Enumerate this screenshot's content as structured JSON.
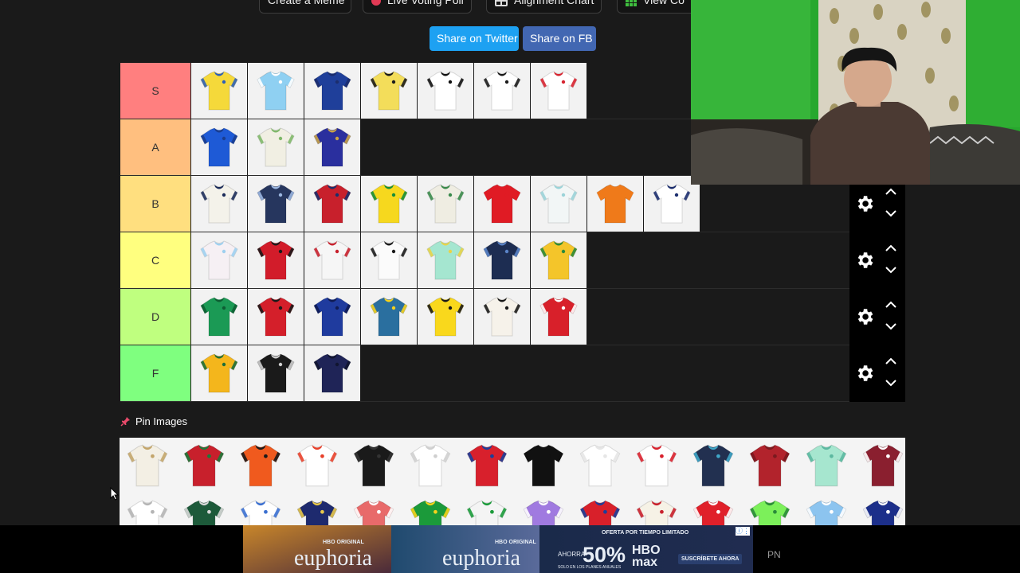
{
  "toolbar": {
    "create_meme": "Create a Meme",
    "live_voting": "Live Voting Poll",
    "alignment_chart": "Alignment Chart",
    "view_community": "View Co"
  },
  "share": {
    "twitter": "Share on Twitter",
    "facebook": "Share on FB"
  },
  "colors": {
    "twitter": "#1da1f2",
    "facebook": "#4267b2",
    "panel_bg": "#1a1a1a",
    "controls_bg": "#000000"
  },
  "tiers": [
    {
      "label": "S",
      "color": "#ff7f7f",
      "jerseys": [
        [
          "#f5d93a",
          "#2d5fb8"
        ],
        [
          "#8fd0f2",
          "#ffffff"
        ],
        [
          "#1f3f9a",
          "#1c2e6e"
        ],
        [
          "#f3dd5a",
          "#1b1b1b"
        ],
        [
          "#ffffff",
          "#111111"
        ],
        [
          "#ffffff",
          "#1a1a1a"
        ],
        [
          "#ffffff",
          "#d62430"
        ]
      ]
    },
    {
      "label": "A",
      "color": "#ffbf7f",
      "jerseys": [
        [
          "#1e5ad6",
          "#1a3d8f"
        ],
        [
          "#f1efe3",
          "#7fb86a"
        ],
        [
          "#2a2f9e",
          "#c8a347"
        ]
      ]
    },
    {
      "label": "B",
      "color": "#ffdf7f",
      "jerseys": [
        [
          "#f4f2ea",
          "#1c2c5a"
        ],
        [
          "#26365e",
          "#9bb6e0"
        ],
        [
          "#c8202c",
          "#1b2f6b"
        ],
        [
          "#f6d81e",
          "#168e3a"
        ],
        [
          "#efede2",
          "#3a8a4c"
        ],
        [
          "#e01b24",
          "#e01b24"
        ],
        [
          "#f2f6f6",
          "#9bd3d8"
        ],
        [
          "#ef7a1a",
          "#ef7a1a"
        ],
        [
          "#ffffff",
          "#1c2e6e"
        ]
      ]
    },
    {
      "label": "C",
      "color": "#ffff7f",
      "jerseys": [
        [
          "#f6f0f4",
          "#9ed0ef"
        ],
        [
          "#d21c2a",
          "#1a1a1a"
        ],
        [
          "#f6f6f6",
          "#c8202c"
        ],
        [
          "#fbfbfb",
          "#1a1a1a"
        ],
        [
          "#a5e6d0",
          "#e8d34a"
        ],
        [
          "#1d2d52",
          "#5a84c8"
        ],
        [
          "#f4c52a",
          "#2c8a3a"
        ]
      ]
    },
    {
      "label": "D",
      "color": "#bfff7f",
      "jerseys": [
        [
          "#1b9a55",
          "#0e5e33"
        ],
        [
          "#d41f2a",
          "#1a1a1a"
        ],
        [
          "#1f3b9e",
          "#101c54"
        ],
        [
          "#2a6f9f",
          "#f6d21c"
        ],
        [
          "#f9d81c",
          "#1a1a1a"
        ],
        [
          "#f6f2ea",
          "#1a1a1a"
        ],
        [
          "#d8202a",
          "#ffffff"
        ]
      ]
    },
    {
      "label": "F",
      "color": "#7fff7f",
      "jerseys": [
        [
          "#f4b61c",
          "#1c6e3a"
        ],
        [
          "#1a1a1a",
          "#cfcfcf"
        ],
        [
          "#1f2457",
          "#111530"
        ]
      ]
    }
  ],
  "pin": {
    "label": "Pin Images",
    "row1": [
      [
        "#f3efe4",
        "#c3a56a"
      ],
      [
        "#c8202c",
        "#1b7a3a"
      ],
      [
        "#f05a1e",
        "#1a1a1a"
      ],
      [
        "#ffffff",
        "#e8402a"
      ],
      [
        "#1a1a1a",
        "#333333"
      ],
      [
        "#ffffff",
        "#cfcfcf"
      ],
      [
        "#d8202c",
        "#1c3f9a"
      ],
      [
        "#111111",
        "#111111"
      ],
      [
        "#ffffff",
        "#e6e6e6"
      ],
      [
        "#ffffff",
        "#d8202c"
      ],
      [
        "#223050",
        "#3fa7c8"
      ],
      [
        "#b2232c",
        "#7a1a1f"
      ],
      [
        "#a6e6cf",
        "#5cb8a0"
      ],
      [
        "#8a1f2f",
        "#ffffff"
      ]
    ],
    "row2": [
      [
        "#ffffff",
        "#b4b4b4"
      ],
      [
        "#1d5a3a",
        "#d8d8d8"
      ],
      [
        "#ffffff",
        "#3a6fd0"
      ],
      [
        "#1e2a6e",
        "#e8c84a"
      ],
      [
        "#e86a6a",
        "#ffffff"
      ],
      [
        "#1b9a3a",
        "#f6d21c"
      ],
      [
        "#f4f4f4",
        "#1b9a3a"
      ],
      [
        "#a07ae0",
        "#ffffff"
      ],
      [
        "#d8202a",
        "#1c3f9a"
      ],
      [
        "#f6f2e6",
        "#c8202c"
      ],
      [
        "#e0202a",
        "#ffffff"
      ],
      [
        "#7cf05a",
        "#2a8a3a"
      ],
      [
        "#8cc4ef",
        "#ffffff"
      ],
      [
        "#1c2f8a",
        "#ffffff"
      ]
    ]
  },
  "ad": {
    "show_name": "euphoria",
    "network_tag": "HBO ORIGINAL",
    "offer_tag": "OFERTA POR TIEMPO LIMITADO",
    "prefix": "AHORRA",
    "discount": "50%",
    "plan_note": "SOLO EN LOS PLANES ANUALES",
    "brand": "HBO max",
    "cta": "SUSCRÍBETE AHORA",
    "corner": "PN"
  }
}
